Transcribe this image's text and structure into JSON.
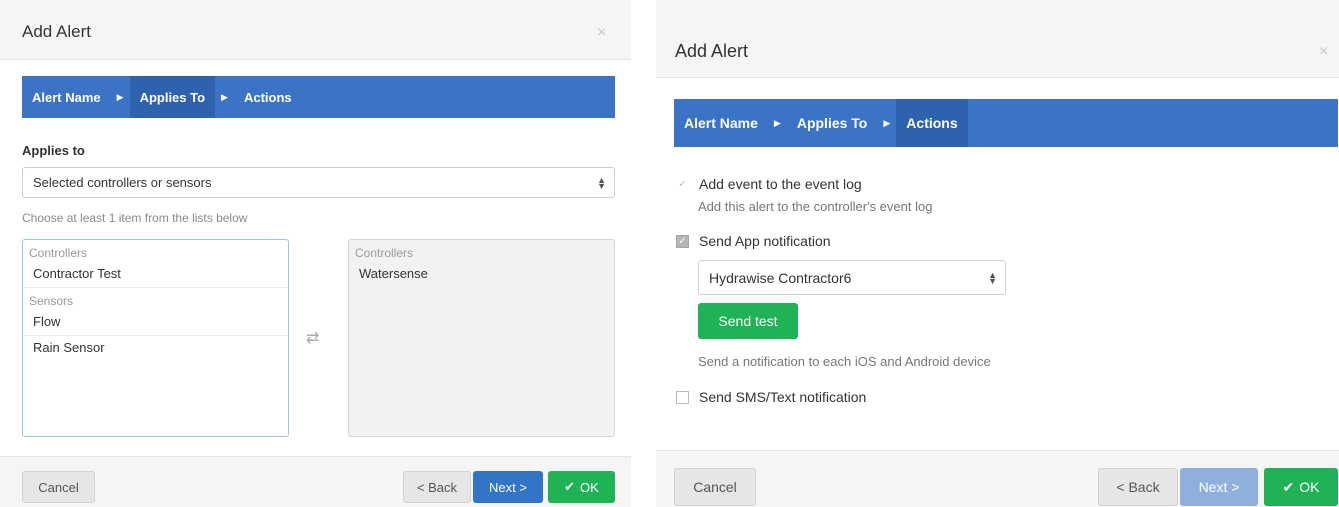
{
  "left_dialog": {
    "title": "Add Alert",
    "close_glyph": "×",
    "wizard": [
      {
        "label": "Alert Name",
        "active": false
      },
      {
        "label": "Applies To",
        "active": true
      },
      {
        "label": "Actions",
        "active": false
      }
    ],
    "wizard_separator": "▶",
    "applies_to_label": "Applies to",
    "applies_to_select": "Selected controllers or sensors",
    "help_text": "Choose at least 1 item from the lists below",
    "available_list": {
      "groups": [
        {
          "name": "Controllers",
          "items": [
            "Contractor Test"
          ]
        },
        {
          "name": "Sensors",
          "items": [
            "Flow",
            "Rain Sensor"
          ]
        }
      ]
    },
    "transfer_icon": "⇄",
    "selected_list": {
      "groups": [
        {
          "name": "Controllers",
          "items": [
            "Watersense"
          ]
        }
      ]
    },
    "buttons": {
      "cancel": "Cancel",
      "back": "< Back",
      "next": "Next >",
      "ok": "OK"
    },
    "ok_icon": "✔"
  },
  "right_dialog": {
    "title": "Add Alert",
    "close_glyph": "×",
    "wizard": [
      {
        "label": "Alert Name",
        "active": false
      },
      {
        "label": "Applies To",
        "active": false
      },
      {
        "label": "Actions",
        "active": true
      }
    ],
    "wizard_separator": "▶",
    "event_log": {
      "label": "Add event to the event log",
      "checked": true,
      "description": "Add this alert to the controller's event log"
    },
    "app_notification": {
      "label": "Send App notification",
      "checked": true
    },
    "device_select": "Hydrawise Contractor6",
    "send_test": "Send test",
    "app_description": "Send a notification to each iOS and Android device",
    "sms_notification": {
      "label": "Send SMS/Text notification",
      "checked": false
    },
    "buttons": {
      "cancel": "Cancel",
      "back": "< Back",
      "next": "Next >",
      "ok": "OK"
    },
    "ok_icon": "✔"
  },
  "colors": {
    "wizard": "#3b74c4",
    "wizard_active": "#2f62ad",
    "primary": "#3274c6",
    "success": "#1fb356"
  }
}
